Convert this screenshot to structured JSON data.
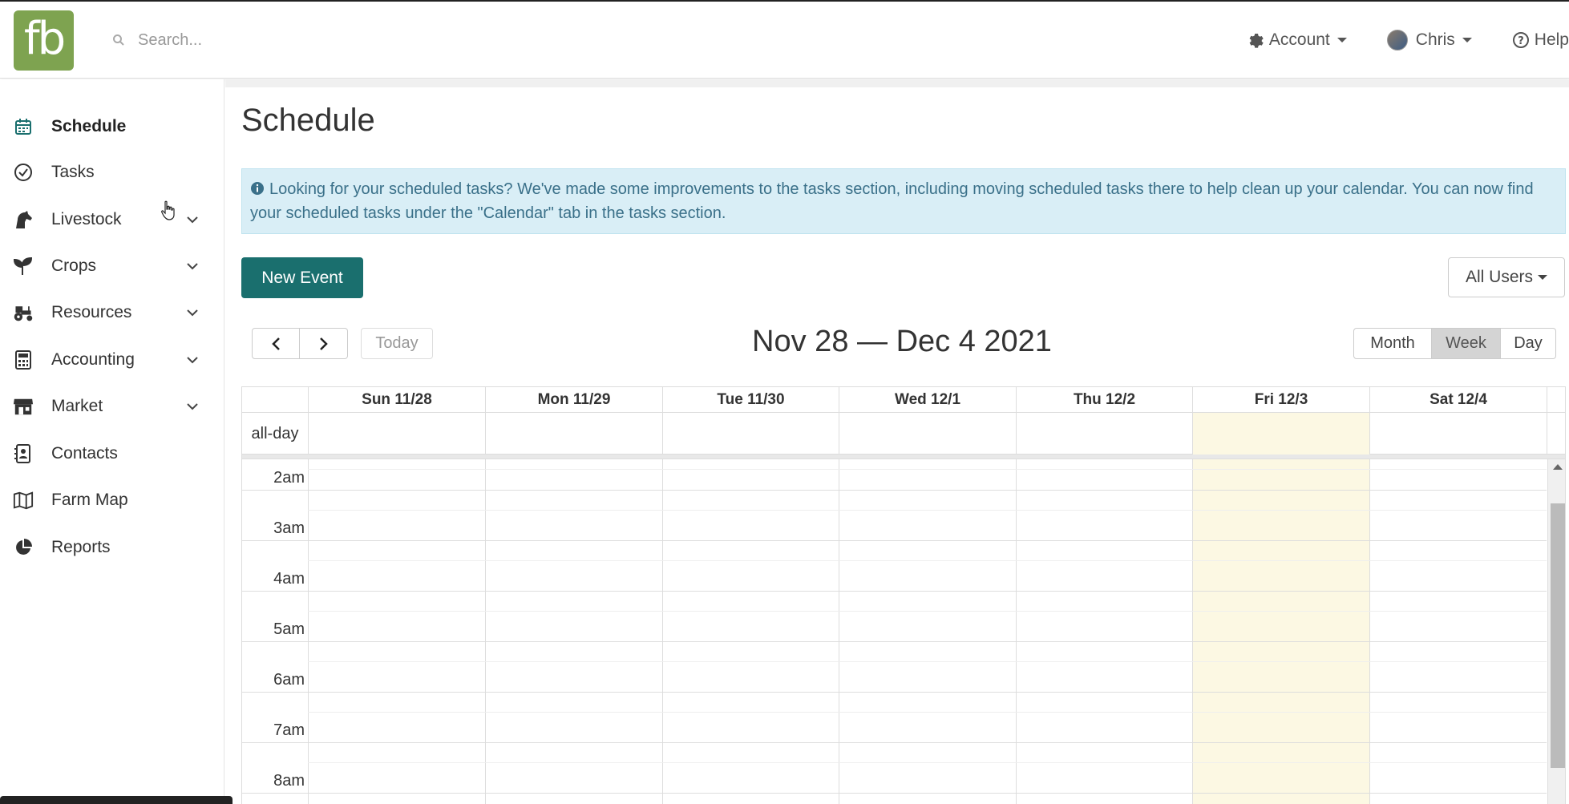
{
  "header": {
    "logo_text": "fb",
    "logo_color": "#7ea350",
    "search_placeholder": "Search...",
    "account_label": "Account",
    "user_label": "Chris",
    "help_label": "Help"
  },
  "sidebar": {
    "items": [
      {
        "label": "Schedule",
        "icon": "calendar-icon",
        "active": true
      },
      {
        "label": "Tasks",
        "icon": "check-circle-icon"
      },
      {
        "label": "Livestock",
        "icon": "horse-icon",
        "expandable": true
      },
      {
        "label": "Crops",
        "icon": "seedling-icon",
        "expandable": true
      },
      {
        "label": "Resources",
        "icon": "tractor-icon",
        "expandable": true
      },
      {
        "label": "Accounting",
        "icon": "calculator-icon",
        "expandable": true
      },
      {
        "label": "Market",
        "icon": "store-icon",
        "expandable": true
      },
      {
        "label": "Contacts",
        "icon": "address-book-icon"
      },
      {
        "label": "Farm Map",
        "icon": "map-icon"
      },
      {
        "label": "Reports",
        "icon": "pie-chart-icon"
      }
    ]
  },
  "main": {
    "title": "Schedule",
    "alert_text": "Looking for your scheduled tasks? We've made some improvements to the tasks section, including moving scheduled tasks there to help clean up your calendar. You can now find your scheduled tasks under the \"Calendar\" tab in the tasks section.",
    "new_event_label": "New Event",
    "users_filter_label": "All Users",
    "today_label": "Today",
    "range_title": "Nov 28 — Dec 4 2021",
    "views": [
      "Month",
      "Week",
      "Day"
    ],
    "active_view": "Week",
    "accent_color": "#1a6f6e"
  },
  "calendar": {
    "allday_label": "all-day",
    "days": [
      "Sun 11/28",
      "Mon 11/29",
      "Tue 11/30",
      "Wed 12/1",
      "Thu 12/2",
      "Fri 12/3",
      "Sat 12/4"
    ],
    "today_index": 5,
    "today_color": "#fcf8e3",
    "hours": [
      "2am",
      "3am",
      "4am",
      "5am",
      "6am",
      "7am",
      "8am"
    ]
  }
}
